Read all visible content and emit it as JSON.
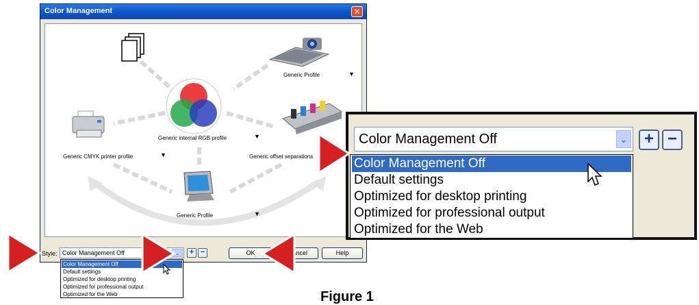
{
  "dialog": {
    "title": "Color Management",
    "close_glyph": "✕",
    "labels": {
      "top_right_profile": "Generic Profile",
      "rgb_profile": "Generic internal RGB profile",
      "cmyk_profile": "Generic CMYK printer profile",
      "offset_profile": "Generic offset separations",
      "monitor_profile": "Generic Profile"
    },
    "dropdown_glyph": "▼",
    "style_label": "Style:",
    "style_value": "Color Management Off",
    "ok_label": "OK",
    "cancel_label": "Cancel",
    "help_label": "Help",
    "add_glyph": "+",
    "remove_glyph": "−"
  },
  "style_options": [
    "Color Management Off",
    "Default settings",
    "Optimized for desktop printing",
    "Optimized for professional output",
    "Optimized for the Web"
  ],
  "zoom": {
    "selected_value": "Color Management Off"
  },
  "figure_label": "Figure 1",
  "colors": {
    "titlebar": "#0f56c8",
    "selection": "#316ac5",
    "pointer_arrow": "#d42020"
  },
  "icons": [
    "documents-icon",
    "scanner-icon",
    "rgb-circles-icon",
    "printer-icon",
    "press-icon",
    "monitor-icon",
    "cursor-icon",
    "pointer-arrow-icon"
  ]
}
